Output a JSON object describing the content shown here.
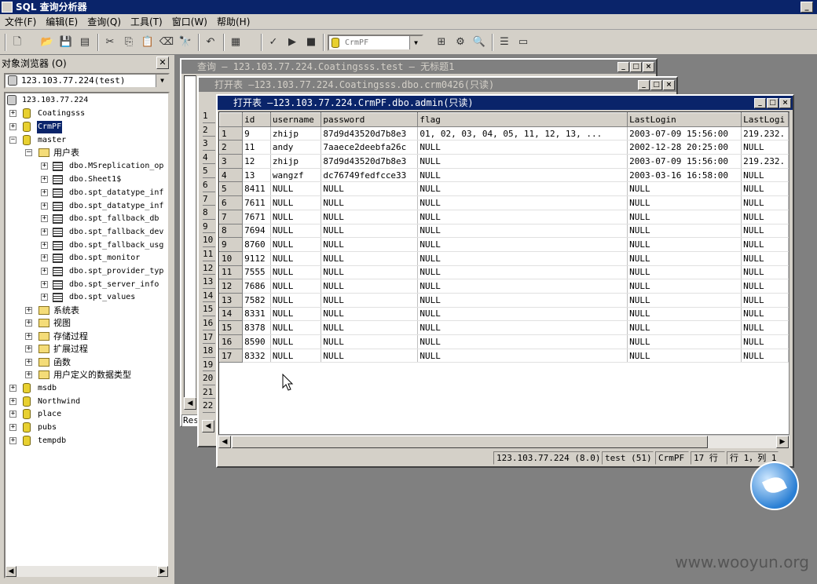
{
  "app": {
    "title": "SQL 查询分析器"
  },
  "menu": [
    "文件(F)",
    "编辑(E)",
    "查询(Q)",
    "工具(T)",
    "窗口(W)",
    "帮助(H)"
  ],
  "toolbar": {
    "database": "CrmPF"
  },
  "objbrowser": {
    "title": "对象浏览器 (O)",
    "server_combo": "123.103.77.224(test)"
  },
  "tree": {
    "server": "123.103.77.224",
    "dbs_top": [
      "Coatingsss",
      "CrmPF",
      "master"
    ],
    "user_tables_folder": "用户表",
    "tables": [
      "dbo.MSreplication_op",
      "dbo.Sheet1$",
      "dbo.spt_datatype_inf",
      "dbo.spt_datatype_inf",
      "dbo.spt_fallback_db",
      "dbo.spt_fallback_dev",
      "dbo.spt_fallback_usg",
      "dbo.spt_monitor",
      "dbo.spt_provider_typ",
      "dbo.spt_server_info",
      "dbo.spt_values"
    ],
    "folders": [
      "系统表",
      "视图",
      "存储过程",
      "扩展过程",
      "函数",
      "用户定义的数据类型"
    ],
    "dbs_bottom": [
      "msdb",
      "Northwind",
      "place",
      "pubs",
      "tempdb"
    ]
  },
  "windows": {
    "query_title": "查询 — 123.103.77.224.Coatingsss.test — 无标题1",
    "table1_title": "打开表 —123.103.77.224.Coatingsss.dbo.crm0426(只读)",
    "table2_title": "打开表 —123.103.77.224.CrmPF.dbo.admin(只读)",
    "query_row_numbers": [
      "1",
      "2",
      "3",
      "4",
      "5",
      "6",
      "7",
      "8",
      "9",
      "10",
      "11",
      "12",
      "13",
      "14",
      "15",
      "16",
      "17",
      "18",
      "19",
      "20",
      "21",
      "22"
    ],
    "query_tab": "Res"
  },
  "grid": {
    "columns": [
      "id",
      "username",
      "password",
      "flag",
      "LastLogin",
      "LastLogi"
    ],
    "rows": [
      [
        "1",
        "9",
        "zhijp",
        "87d9d43520d7b8e3",
        "01, 02, 03, 04, 05, 11, 12, 13, ...",
        "2003-07-09 15:56:00",
        "219.232."
      ],
      [
        "2",
        "11",
        "andy",
        "7aaece2deebfa26c",
        "NULL",
        "2002-12-28 20:25:00",
        "NULL"
      ],
      [
        "3",
        "12",
        "zhijp",
        "87d9d43520d7b8e3",
        "NULL",
        "2003-07-09 15:56:00",
        "219.232."
      ],
      [
        "4",
        "13",
        "wangzf",
        "dc76749fedfcce33",
        "NULL",
        "2003-03-16 16:58:00",
        "NULL"
      ],
      [
        "5",
        "8411",
        "NULL",
        "NULL",
        "NULL",
        "NULL",
        "NULL"
      ],
      [
        "6",
        "7611",
        "NULL",
        "NULL",
        "NULL",
        "NULL",
        "NULL"
      ],
      [
        "7",
        "7671",
        "NULL",
        "NULL",
        "NULL",
        "NULL",
        "NULL"
      ],
      [
        "8",
        "7694",
        "NULL",
        "NULL",
        "NULL",
        "NULL",
        "NULL"
      ],
      [
        "9",
        "8760",
        "NULL",
        "NULL",
        "NULL",
        "NULL",
        "NULL"
      ],
      [
        "10",
        "9112",
        "NULL",
        "NULL",
        "NULL",
        "NULL",
        "NULL"
      ],
      [
        "11",
        "7555",
        "NULL",
        "NULL",
        "NULL",
        "NULL",
        "NULL"
      ],
      [
        "12",
        "7686",
        "NULL",
        "NULL",
        "NULL",
        "NULL",
        "NULL"
      ],
      [
        "13",
        "7582",
        "NULL",
        "NULL",
        "NULL",
        "NULL",
        "NULL"
      ],
      [
        "14",
        "8331",
        "NULL",
        "NULL",
        "NULL",
        "NULL",
        "NULL"
      ],
      [
        "15",
        "8378",
        "NULL",
        "NULL",
        "NULL",
        "NULL",
        "NULL"
      ],
      [
        "16",
        "8590",
        "NULL",
        "NULL",
        "NULL",
        "NULL",
        "NULL"
      ],
      [
        "17",
        "8332",
        "NULL",
        "NULL",
        "NULL",
        "NULL",
        "NULL"
      ]
    ]
  },
  "status": {
    "server": "123.103.77.224 (8.0)",
    "user": "test (51)",
    "db": "CrmPF",
    "rows": "17 行",
    "pos": "行 1，列 1"
  },
  "watermark": "www.wooyun.org"
}
